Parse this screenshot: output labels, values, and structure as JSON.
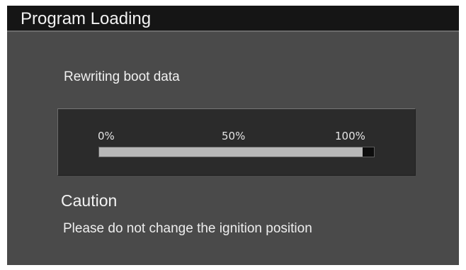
{
  "window": {
    "title": "Program Loading"
  },
  "status": {
    "message": "Rewriting boot data"
  },
  "progress": {
    "scale_labels": [
      "0%",
      "50%",
      "100%"
    ],
    "level_percent": 96
  },
  "caution": {
    "title": "Caution",
    "message": "Please do not change the ignition position"
  },
  "colors": {
    "screen_background": "#4a4a4a",
    "title_bar": "#151515",
    "panel_background": "#2b2b2b",
    "progress_fill": "#b8b8b8",
    "text": "#f0f0f0"
  }
}
